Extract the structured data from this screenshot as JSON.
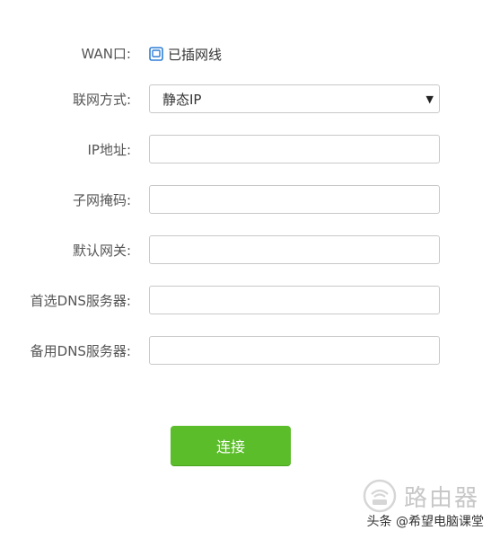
{
  "wan": {
    "label": "WAN口:",
    "status": "已插网线",
    "icon": "ethernet-port-icon",
    "icon_color": "#2f7fd6"
  },
  "connection_mode": {
    "label": "联网方式:",
    "selected": "静态IP"
  },
  "ip_address": {
    "label": "IP地址:",
    "value": ""
  },
  "subnet_mask": {
    "label": "子网掩码:",
    "value": ""
  },
  "default_gateway": {
    "label": "默认网关:",
    "value": ""
  },
  "primary_dns": {
    "label": "首选DNS服务器:",
    "value": ""
  },
  "secondary_dns": {
    "label": "备用DNS服务器:",
    "value": ""
  },
  "connect_button": {
    "label": "连接",
    "color": "#5bbd2a"
  },
  "watermark": {
    "logo_text": "路由器",
    "credit": "头条 @希望电脑课堂"
  }
}
